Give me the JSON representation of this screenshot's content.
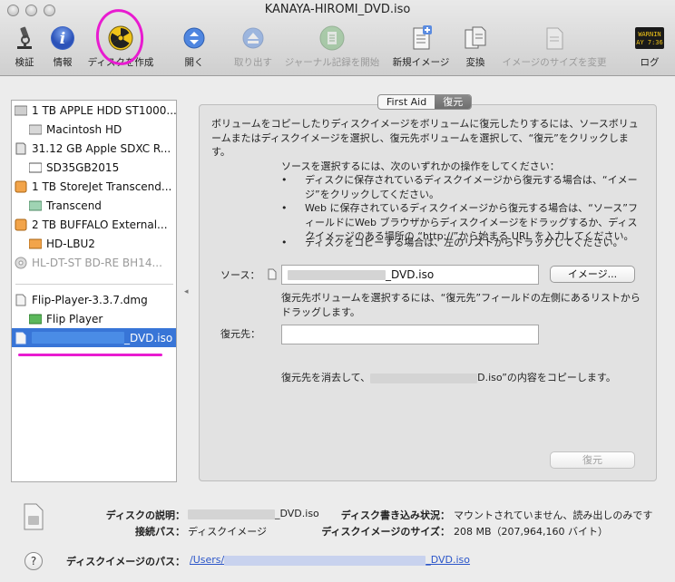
{
  "window": {
    "title": "KANAYA-HIROMI_DVD.iso"
  },
  "toolbar": {
    "verify": "検証",
    "info": "情報",
    "burn": "ディスクを作成",
    "open": "開く",
    "eject": "取り出す",
    "journal": "ジャーナル記録を開始",
    "new_image": "新規イメージ",
    "convert": "変換",
    "resize": "イメージのサイズを変更",
    "log": "ログ",
    "log_icon_text1": "WARNIN",
    "log_icon_text2": "AY 7:36"
  },
  "sidebar": {
    "items": [
      {
        "label": "1 TB APPLE HDD ST1000..."
      },
      {
        "label": "Macintosh HD"
      },
      {
        "label": "31.12 GB Apple SDXC R..."
      },
      {
        "label": "SD35GB2015"
      },
      {
        "label": "1 TB StoreJet Transcend..."
      },
      {
        "label": "Transcend"
      },
      {
        "label": "2 TB BUFFALO External..."
      },
      {
        "label": "HD-LBU2"
      },
      {
        "label": "HL-DT-ST BD-RE BH14..."
      },
      {
        "label": "Flip-Player-3.3.7.dmg"
      },
      {
        "label": "Flip Player"
      },
      {
        "label": "_DVD.iso"
      }
    ]
  },
  "tabs": {
    "first_aid": "First Aid",
    "restore": "復元"
  },
  "restore": {
    "intro": "ボリュームをコピーしたりディスクイメージをボリュームに復元したりするには、ソースボリュームまたはディスクイメージを選択し、復元先ボリュームを選択して、“復元”をクリックします。",
    "how_title": "ソースを選択するには、次のいずれかの操作をしてください：",
    "bullet1": "ディスクに保存されているディスクイメージから復元する場合は、“イメージ”をクリックしてください。",
    "bullet2": "Web に保存されているディスクイメージから復元する場合は、“ソース”フィールドにWeb ブラウザからディスクイメージをドラッグするか、ディスクイメージのある場所の “http://”から始まる URL を入力してください。",
    "bullet3": "ディスクをコピーする場合は、左のリストからドラッグしてください。",
    "source_label": "ソース：",
    "source_value": "_DVD.iso",
    "image_button": "イメージ...",
    "dest_hint": "復元先ボリュームを選択するには、“復元先”フィールドの左側にあるリストからドラッグします。",
    "dest_label": "復元先：",
    "dest_value": "",
    "erase_prefix": "復元先を消去して、",
    "erase_suffix": "D.iso”の内容をコピーします。",
    "restore_button": "復元"
  },
  "footer": {
    "desc_label": "ディスクの説明：",
    "desc_value": "_DVD.iso",
    "write_label": "ディスク書き込み状況：",
    "write_value": "マウントされていません、読み出しのみです",
    "conn_label": "接続パス：",
    "conn_value": "ディスクイメージ",
    "size_label": "ディスクイメージのサイズ：",
    "size_value": "208 MB（207,964,160 バイト）",
    "path_label": "ディスクイメージのパス：",
    "path_prefix": "/Users/",
    "path_suffix": "_DVD.iso",
    "help": "?"
  }
}
